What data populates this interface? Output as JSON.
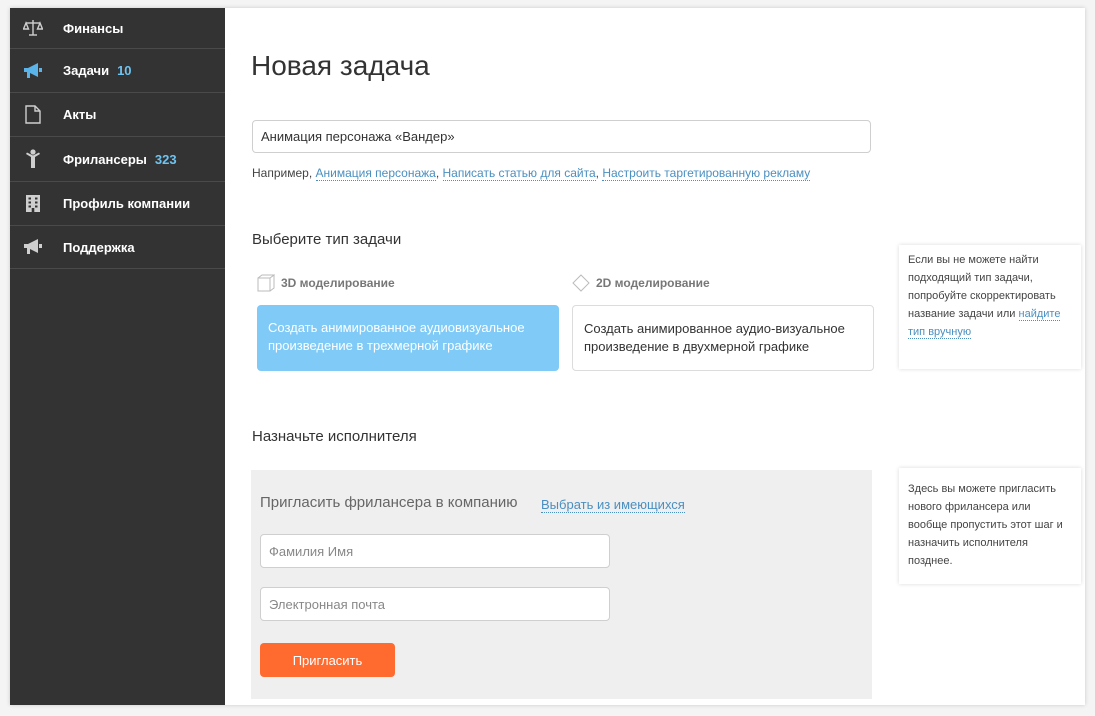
{
  "sidebar": {
    "items": [
      {
        "label": "Финансы",
        "icon": "scales-icon",
        "count": ""
      },
      {
        "label": "Задачи",
        "icon": "megaphone-icon",
        "count": "10"
      },
      {
        "label": "Акты",
        "icon": "document-icon",
        "count": ""
      },
      {
        "label": "Фрилансеры",
        "icon": "person-icon",
        "count": "323"
      },
      {
        "label": "Профиль компании",
        "icon": "building-icon",
        "count": ""
      },
      {
        "label": "Поддержка",
        "icon": "megaphone-icon",
        "count": ""
      }
    ]
  },
  "main": {
    "title": "Новая задача",
    "task_name_value": "Анимация персонажа «Вандер»",
    "examples": {
      "prefix": "Например,",
      "links": [
        "Анимация персонажа",
        "Написать статью для сайта",
        "Настроить таргетированную рекламу"
      ]
    },
    "task_type": {
      "title": "Выберите тип задачи",
      "options": [
        {
          "label": "3D моделирование",
          "description": "Создать анимированное аудиовизуальное произведение в трехмерной графике",
          "selected": true
        },
        {
          "label": "2D моделирование",
          "description": "Создать анимированное аудио-визуальное произведение в двухмерной графике",
          "selected": false
        }
      ],
      "hint": {
        "text": "Если вы не можете найти подходящий тип задачи, попробуйте скорректировать название задачи или",
        "link": "найдите тип вручную"
      }
    },
    "assignee": {
      "title": "Назначьте исполнителя",
      "invite_title": "Пригласить фрилансера в компанию",
      "choose_link": "Выбрать из имеющихся",
      "name_placeholder": "Фамилия Имя",
      "email_placeholder": "Электронная почта",
      "invite_button": "Пригласить",
      "hint": "Здесь вы можете пригласить нового фрилансера или вообще пропустить этот шаг и назначить исполнителя позднее."
    }
  },
  "colors": {
    "sidebar_bg": "#333333",
    "accent_blue": "#7fcaf6",
    "link": "#4a8fc0",
    "count": "#6fc3f0",
    "invite_button": "#ff6a2f"
  }
}
